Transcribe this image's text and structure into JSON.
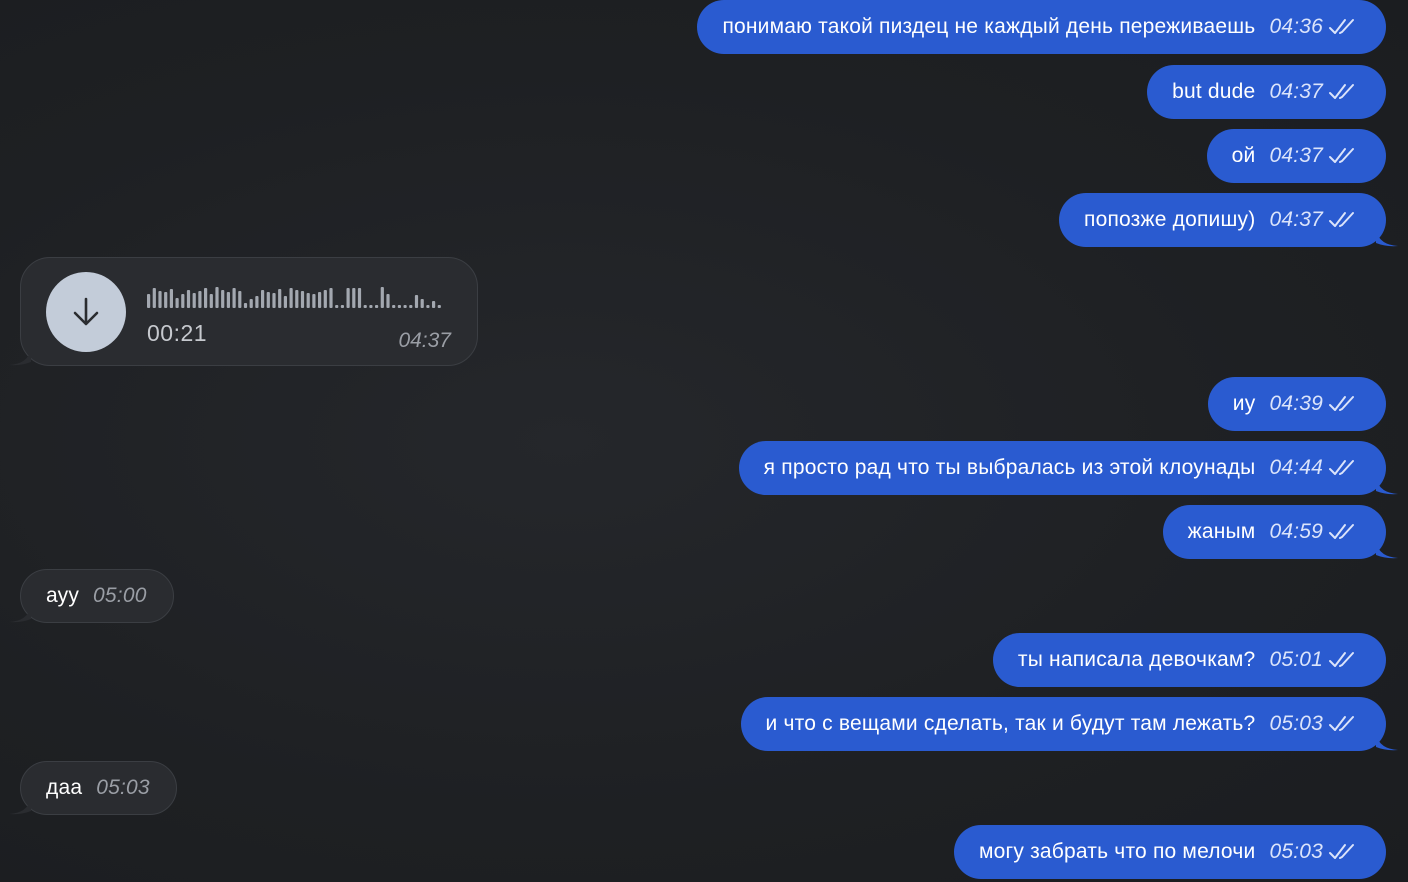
{
  "colors": {
    "background": "#1f2124",
    "outgoing_bubble": "#2a5bd0",
    "incoming_bubble": "#2a2c30",
    "read_ticks": "#dbe4fb"
  },
  "messages": [
    {
      "text": "понимаю такой пиздец не каждый день переживаешь",
      "time": "04:36",
      "ticks": "double-check-icon"
    },
    {
      "text": "but dude",
      "time": "04:37",
      "ticks": "double-check-icon"
    },
    {
      "text": "ой",
      "time": "04:37",
      "ticks": "double-check-icon"
    },
    {
      "text": "попозже допишу)",
      "time": "04:37",
      "ticks": "double-check-icon"
    },
    {
      "duration": "00:21",
      "time": "04:37",
      "icon": "download-arrow-icon"
    },
    {
      "text": "иу",
      "time": "04:39",
      "ticks": "double-check-icon"
    },
    {
      "text": "я просто рад что ты выбралась из этой клоунады",
      "time": "04:44",
      "ticks": "double-check-icon"
    },
    {
      "text": "жаным",
      "time": "04:59",
      "ticks": "double-check-icon"
    },
    {
      "text": "ауу",
      "time": "05:00"
    },
    {
      "text": "ты написала девочкам?",
      "time": "05:01",
      "ticks": "double-check-icon"
    },
    {
      "text": "и что с вещами сделать, так и будут там лежать?",
      "time": "05:03",
      "ticks": "double-check-icon"
    },
    {
      "text": "даа",
      "time": "05:03"
    },
    {
      "text": "могу забрать что по мелочи",
      "time": "05:03",
      "ticks": "double-check-icon"
    }
  ]
}
